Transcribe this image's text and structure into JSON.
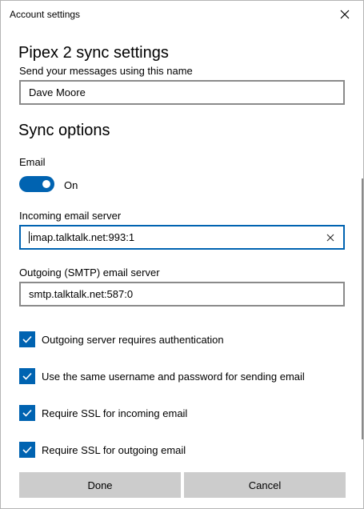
{
  "window": {
    "title": "Account settings"
  },
  "heading": "Pipex 2 sync settings",
  "name_field": {
    "label": "Send your messages using this name",
    "value": "Dave Moore"
  },
  "sync": {
    "heading": "Sync options",
    "email_label": "Email",
    "email_toggle_state": "On",
    "incoming": {
      "label": "Incoming email server",
      "value": "imap.talktalk.net:993:1"
    },
    "outgoing": {
      "label": "Outgoing (SMTP) email server",
      "value": "smtp.talktalk.net:587:0"
    }
  },
  "checkboxes": [
    {
      "label": "Outgoing server requires authentication",
      "checked": true
    },
    {
      "label": "Use the same username and password for sending email",
      "checked": true
    },
    {
      "label": "Require SSL for incoming email",
      "checked": true
    },
    {
      "label": "Require SSL for outgoing email",
      "checked": true
    }
  ],
  "buttons": {
    "done": "Done",
    "cancel": "Cancel"
  },
  "colors": {
    "accent": "#0063b1",
    "button_bg": "#cccccc"
  }
}
